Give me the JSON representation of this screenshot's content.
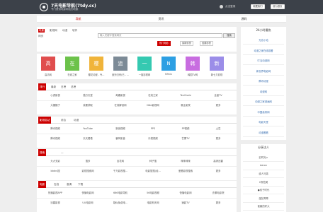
{
  "header": {
    "title": "7天电影导航(7tdy.cc)",
    "subtitle": "专门提供电影网站的收集",
    "login": "点击登录",
    "btn_favorite": "收藏我们",
    "btn_home": "设为首页"
  },
  "nav": [
    "导航",
    "资讯",
    "源码"
  ],
  "search": {
    "tabs": [
      "电影",
      "影视网",
      "动漫",
      "软件"
    ],
    "tab2": "网页",
    "placeholder": "输入关键字搜索网页",
    "button": "搜索",
    "hot": [
      "热门电影",
      "最新影视",
      "经典影视"
    ]
  },
  "tiles": {
    "items": [
      {
        "char": "高",
        "label": "高清网",
        "color": "#e04e4e"
      },
      {
        "char": "在",
        "label": "在线之家",
        "color": "#6cc24a"
      },
      {
        "char": "樱",
        "label": "樱花动漫 - 专...",
        "color": "#f0b43a"
      },
      {
        "char": "追",
        "label": "追光归来(已 - ...",
        "color": "#7c8a96"
      },
      {
        "char": "一",
        "label": "一独影视网",
        "color": "#35c9b1"
      },
      {
        "char": "N",
        "label": "Nfmix",
        "color": "#2d9fe3"
      },
      {
        "char": "韩",
        "label": "韩国TV网",
        "color": "#c86de0"
      },
      {
        "char": "新",
        "label": "新七又影视",
        "color": "#9b8de8"
      }
    ]
  },
  "list1": {
    "tabs": [
      "排行",
      "最新",
      "日榜",
      "总榜"
    ],
    "rows": [
      [
        "小虎影视",
        "猫万天堂",
        "奇趣影视",
        "在线之家",
        "TenlCode",
        "全量TV"
      ],
      [
        "大猩猩子",
        "我要获取",
        "在线解谜网",
        "Nike影视网",
        "霸主影院",
        "更多"
      ]
    ]
  },
  "list2": {
    "tabs": [
      "影视名站",
      "综合",
      "动漫"
    ],
    "rows": [
      [
        "腾讯视频",
        "YouTube",
        "新浪视频",
        "PPS",
        "PP视频",
        "土豆"
      ],
      [
        "腾讯视频",
        "天天看看",
        "暴风影音",
        "乐视视频",
        "芒果TV",
        "更多"
      ]
    ]
  },
  "list3": {
    "tabs": [
      "搜索",
      "—"
    ],
    "rows": [
      [
        "大大无影",
        "搜多",
        "百花网",
        "种子搜",
        "咪咪咪咪",
        "高清迅雷"
      ],
      [
        "btdns搜",
        "影视搜索网",
        "千万影视搜...",
        "电影搜搜(经...",
        "爱看影视搜索",
        "更多"
      ]
    ]
  },
  "list4": {
    "tabs": [
      "电影",
      "在线",
      "高清",
      "下载"
    ],
    "rows": [
      [
        "快播影视APP",
        "快播电影网",
        "666电影导航",
        "56电影视频",
        "快播电影网",
        "去哪电影院"
      ],
      [
        "迅雷影视",
        "UU电影网",
        "疑似免费电...",
        "电影狗天网",
        "速影TV",
        "更多"
      ]
    ]
  },
  "side1": {
    "title": "24小时最热",
    "items": [
      "无名小站",
      "动漫之家在线观看",
      "叮当动漫网",
      "新世界电影网",
      "腾讯动漫",
      "动漫网",
      "动漫之家漫画网",
      "中国高清网",
      "电影天堂",
      "动漫看看"
    ]
  },
  "side2": {
    "title": "分享达人",
    "items": [
      "旧时光>",
      "Aaron",
      "波人兄弟",
      "C规范美",
      "●双子时代",
      "漫友哥哥",
      "谁最的好大"
    ]
  }
}
